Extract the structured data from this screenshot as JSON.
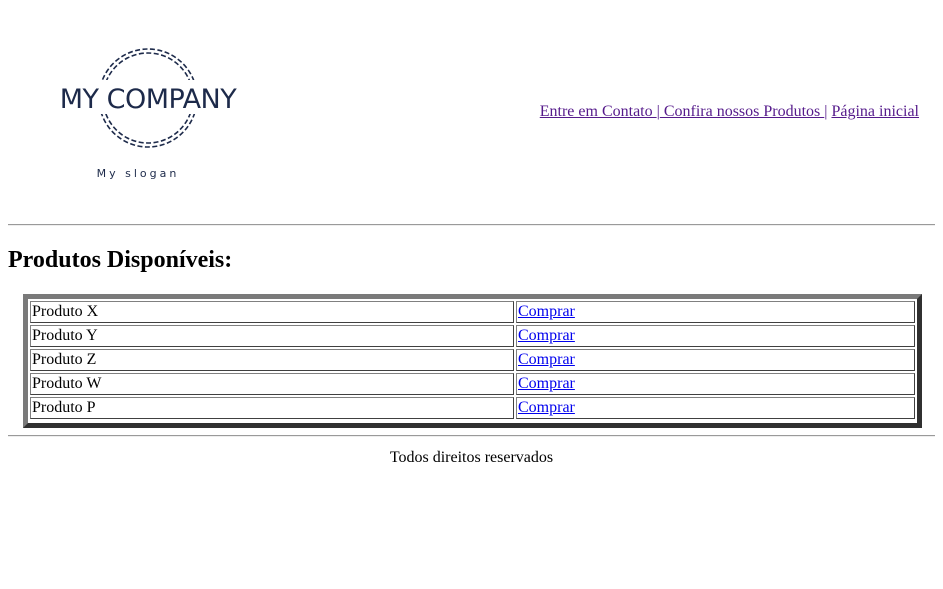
{
  "header": {
    "logo_text": "MY COMPANY",
    "slogan": "My slogan",
    "logo_color": "#1d2a4a",
    "nav": [
      {
        "label": "Entre em Contato "
      },
      {
        "label": " Confira nossos Produtos "
      },
      {
        "label": "Página inicial"
      }
    ],
    "nav_separator": "|"
  },
  "main": {
    "heading": "Produtos Disponíveis:",
    "products": [
      {
        "name": "Produto X",
        "action": "Comprar"
      },
      {
        "name": "Produto Y",
        "action": "Comprar"
      },
      {
        "name": "Produto Z",
        "action": "Comprar"
      },
      {
        "name": "Produto W",
        "action": "Comprar"
      },
      {
        "name": "Produto P",
        "action": "Comprar"
      }
    ]
  },
  "footer": {
    "text": "Todos direitos reservados"
  },
  "colors": {
    "visited_link": "#551a8b",
    "link": "#0000ee"
  }
}
